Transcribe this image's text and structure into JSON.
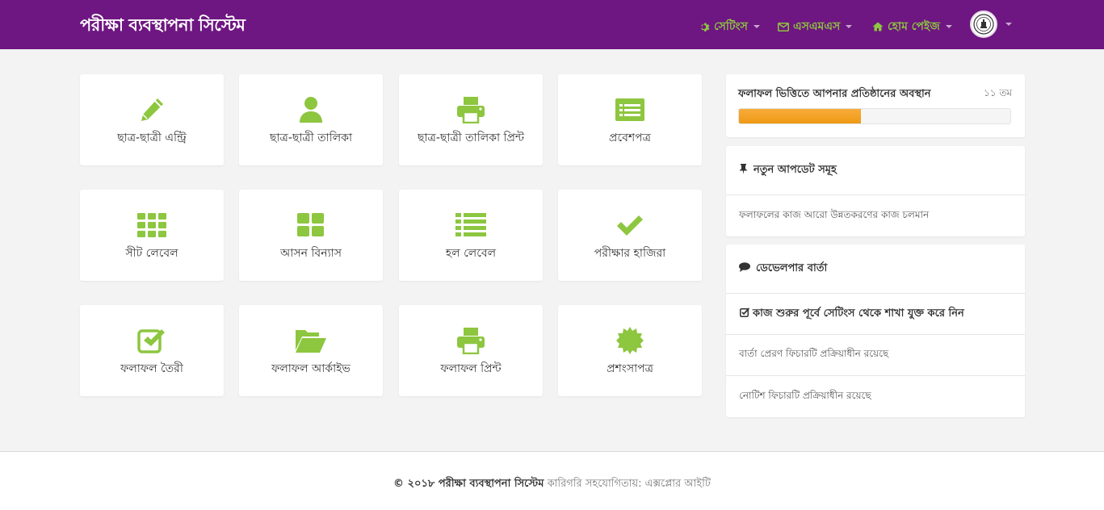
{
  "header": {
    "brand": "পরীক্ষা ব্যবস্থাপনা সিস্টেম",
    "nav": [
      {
        "label": "সেটিংস",
        "icon": "gear-icon"
      },
      {
        "label": "এসএমএস",
        "icon": "envelope-icon"
      },
      {
        "label": "হোম পেইজ",
        "icon": "home-icon"
      }
    ],
    "accent_color": "#8dc63f",
    "bar_color": "#6e1681"
  },
  "tiles": [
    {
      "label": "ছাত্র-ছাত্রী এন্ট্রি",
      "icon": "pencil-icon"
    },
    {
      "label": "ছাত্র-ছাত্রী তালিকা",
      "icon": "user-icon"
    },
    {
      "label": "ছাত্র-ছাত্রী তালিকা প্রিন্ট",
      "icon": "printer-icon"
    },
    {
      "label": "প্রবেশপত্র",
      "icon": "id-card-icon"
    },
    {
      "label": "সীট লেবেল",
      "icon": "grid-icon"
    },
    {
      "label": "আসন বিন্যাস",
      "icon": "tiles-icon"
    },
    {
      "label": "হল লেবেল",
      "icon": "list-icon"
    },
    {
      "label": "পরীক্ষার হাজিরা",
      "icon": "checkmark-icon"
    },
    {
      "label": "ফলাফল তৈরী",
      "icon": "checkbox-icon"
    },
    {
      "label": "ফলাফল আর্কাইভ",
      "icon": "folder-open-icon"
    },
    {
      "label": "ফলাফল প্রিন্ট",
      "icon": "printer-icon"
    },
    {
      "label": "প্রশংসাপত্র",
      "icon": "certificate-icon"
    }
  ],
  "rank_panel": {
    "title": "ফলাফল ভিত্তিতে আপনার প্রতিষ্ঠানের অবস্থান",
    "value": "১১ তম",
    "progress": 0.45,
    "progress_color": "#f5a623"
  },
  "updates_panel": {
    "title": "নতুন আপডেট সমূহ",
    "items": [
      "ফলাফলের কাজ আরো উন্নতকরণের কাজ চলমান"
    ]
  },
  "developer_panel": {
    "title": "ডেভেলপার বার্তা",
    "highlight": "কাজ শুরুর পূর্বে সেটিংস থেকে শাখা যুক্ত করে নিন",
    "items": [
      "বার্তা প্রেরণ ফিচারটি প্রক্রিয়াধীন রয়েছে",
      "নোটিশ ফিচারটি প্রক্রিয়াধীন রয়েছে"
    ]
  },
  "footer": {
    "copyright": "© ২০১৮ পরীক্ষা ব্যবস্থাপনা সিস্টেম",
    "credit": "কারিগরি সহযোগিতায়: এক্সপ্লোর আইটি"
  }
}
